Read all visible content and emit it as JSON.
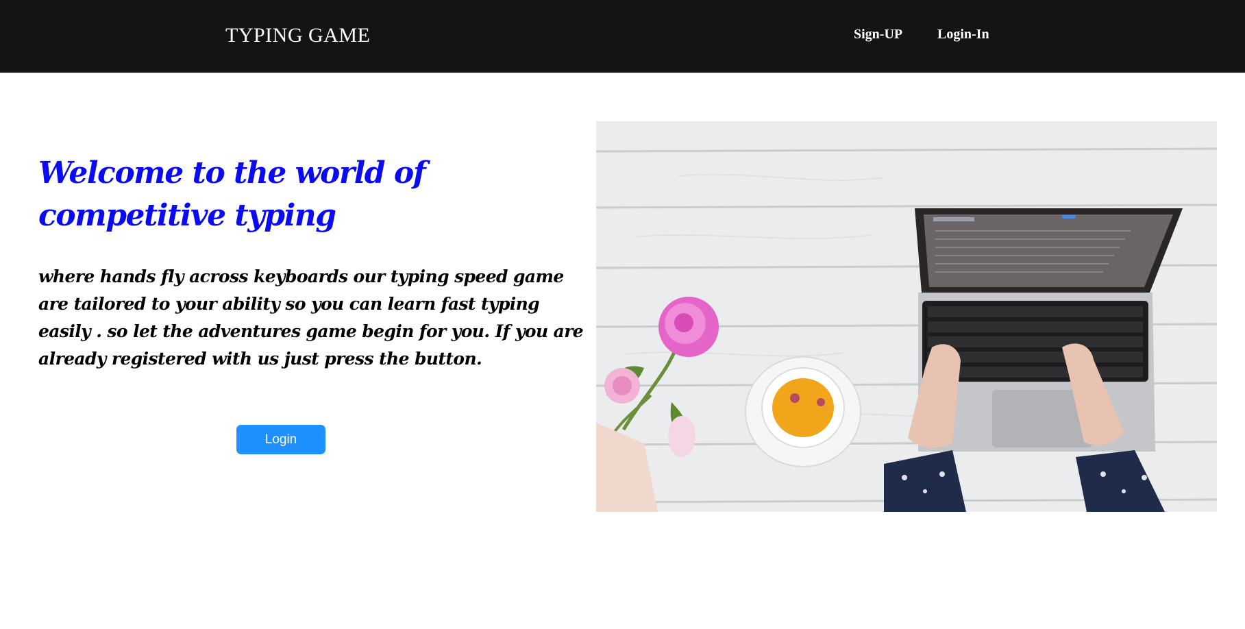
{
  "navbar": {
    "brand": "TYPING GAME",
    "links": [
      {
        "label": "Sign-UP"
      },
      {
        "label": "Login-In"
      }
    ]
  },
  "hero": {
    "headline": "Welcome to the world of competitive typing",
    "intro": "where hands fly across keyboards our typing speed game are tailored to your ability so you can learn fast typing easily . so let the adventures game begin for you. If you are already registered with us just press the button.",
    "login_button": "Login"
  },
  "colors": {
    "navbar_bg": "#161412",
    "headline": "#0b0bf2",
    "button": "#1e90ff"
  },
  "image": {
    "subject": "desk-with-laptop-tea-and-flowers",
    "icons": [
      "laptop-icon",
      "teacup-icon",
      "flower-icon",
      "hands-icon"
    ]
  }
}
